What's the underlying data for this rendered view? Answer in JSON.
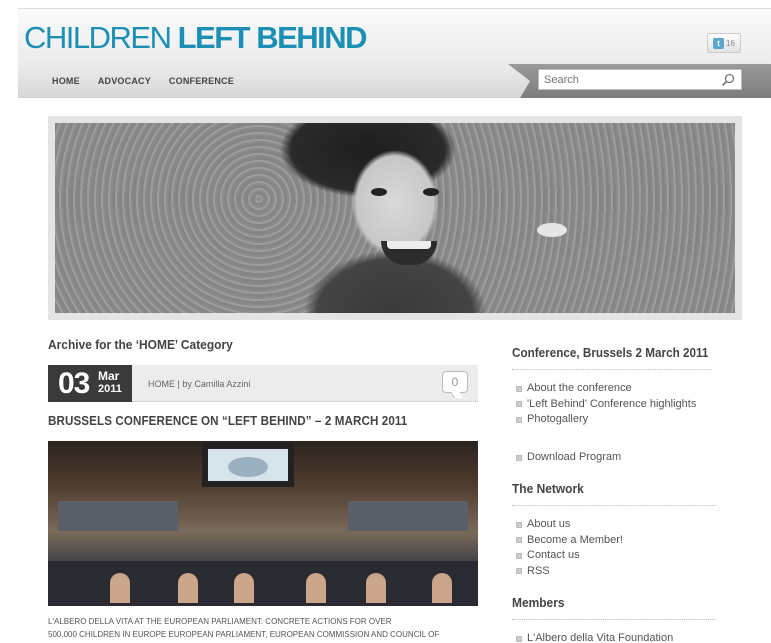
{
  "header": {
    "logo_part1": "CHILDREN ",
    "logo_part2": "LEFT BEHIND",
    "twitter_count": "16"
  },
  "nav": {
    "items": [
      "HOME",
      "ADVOCACY",
      "CONFERENCE"
    ],
    "search_placeholder": "Search"
  },
  "main": {
    "archive_title": "Archive for the ‘HOME’ Category",
    "post": {
      "day": "03",
      "month": "Mar",
      "year": "2011",
      "meta": "HOME | by Camilla Azzini",
      "comment_count": "0",
      "title": "BRUSSELS CONFERENCE ON “LEFT BEHIND” – 2 MARCH 2011",
      "excerpt_line1": "L'ALBERO DELLA VITA AT THE EUROPEAN PARLIAMENT: CONCRETE ACTIONS FOR OVER",
      "excerpt_line2": "500.000 CHILDREN IN EUROPE European Parliament, European Commission and Council of"
    }
  },
  "sidebar": {
    "conference": {
      "title": "Conference, Brussels 2 March 2011",
      "links": [
        "About the conference",
        "'Left Behind' Conference highlights",
        "Photogallery"
      ],
      "download": "Download Program"
    },
    "network": {
      "title": "The Network",
      "links": [
        "About us",
        "Become a Member!",
        "Contact us",
        "RSS"
      ]
    },
    "members": {
      "title": "Members",
      "links": [
        "L'Albero della Vita Foundation"
      ]
    }
  },
  "colors": {
    "brand": "#1c8fb4",
    "nav_dark": "#8a8a8a",
    "date_box": "#3a3a3a"
  }
}
